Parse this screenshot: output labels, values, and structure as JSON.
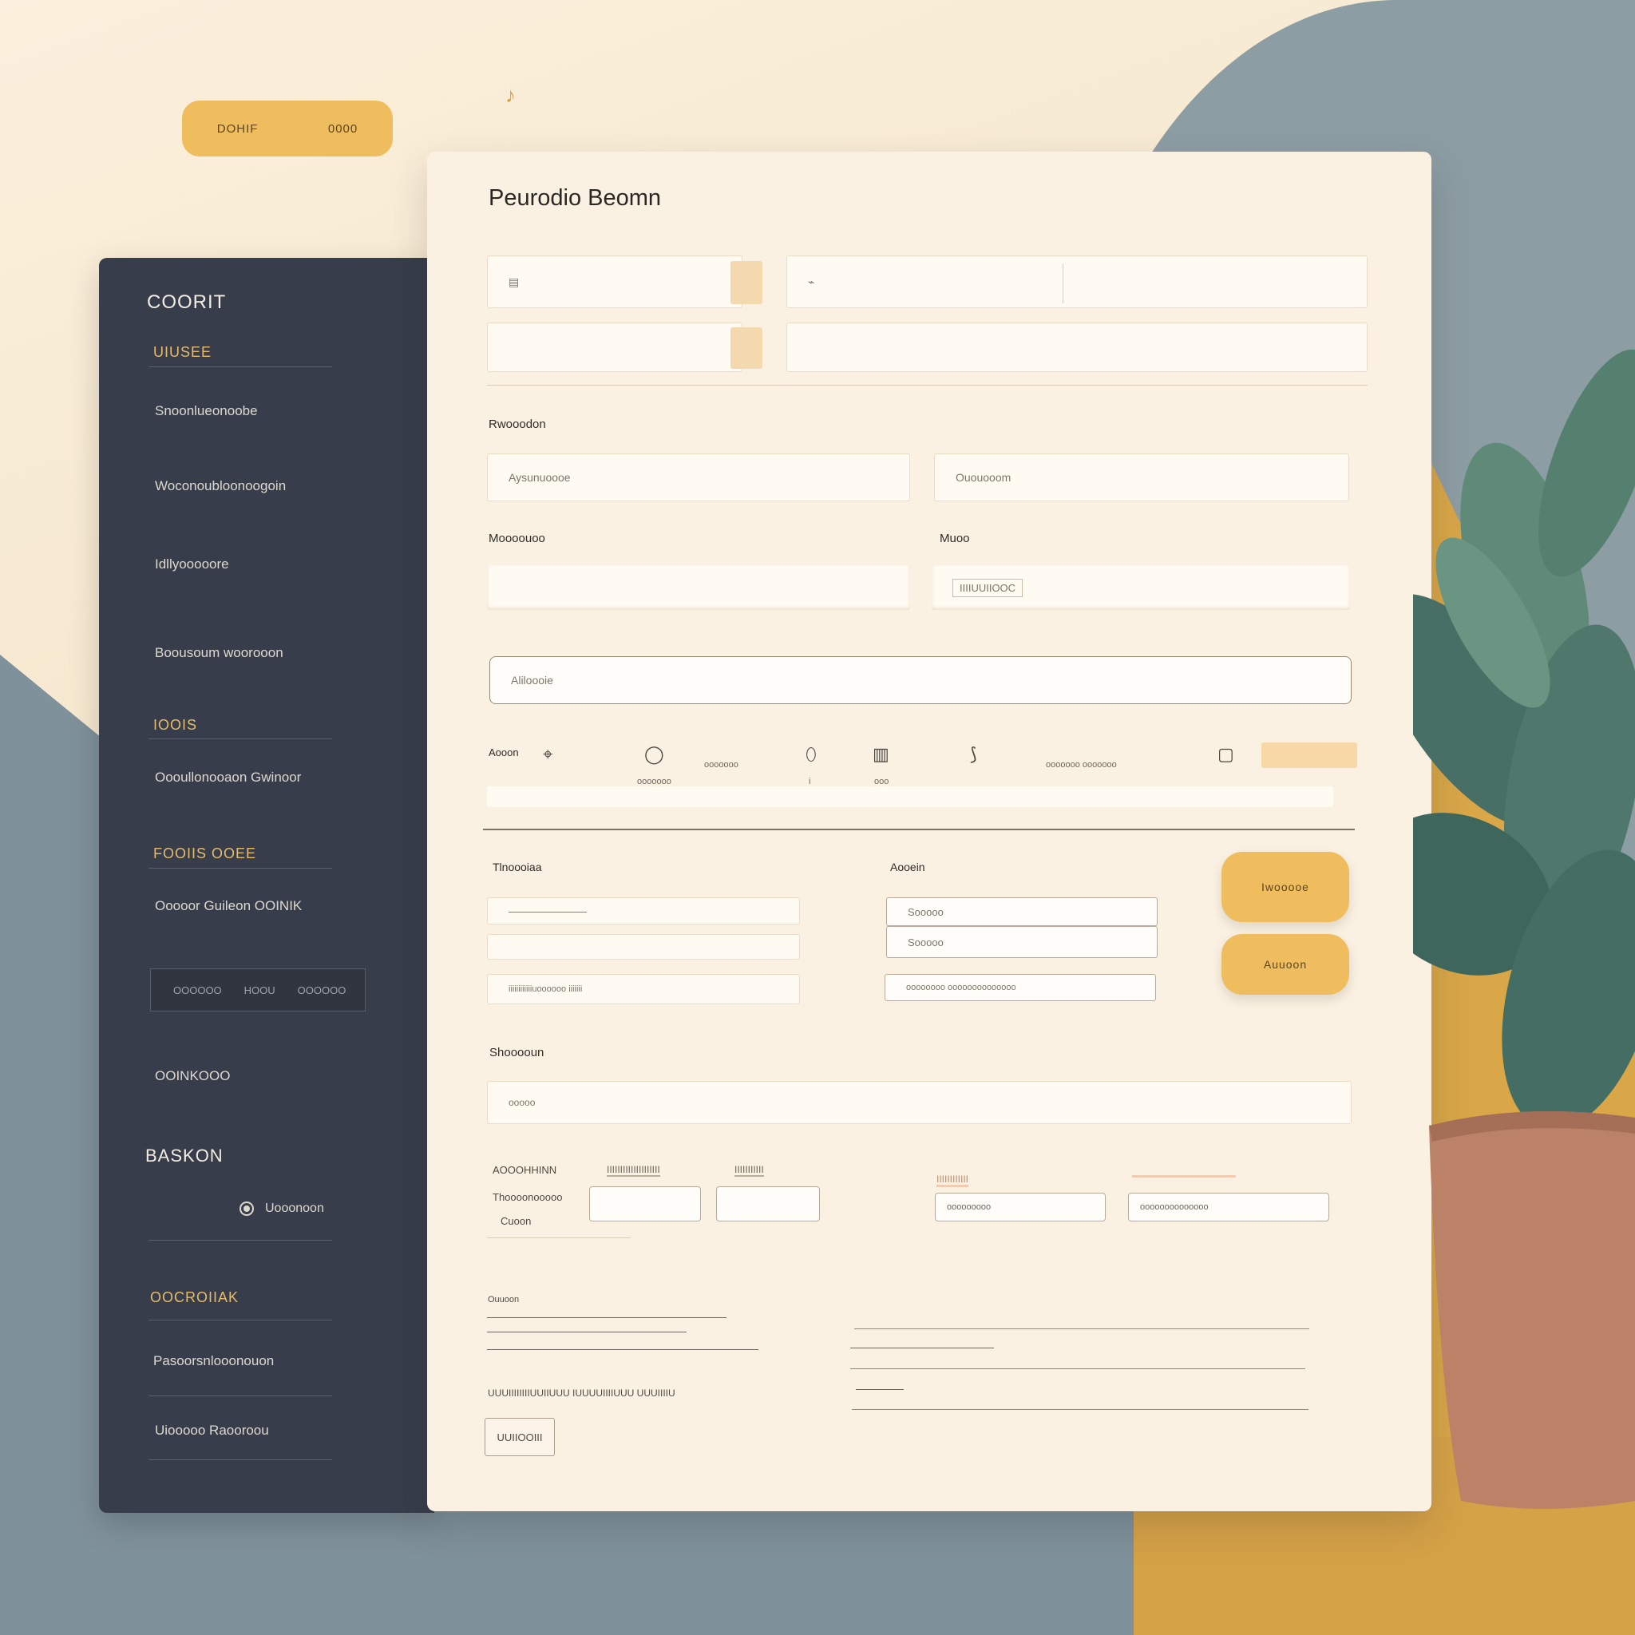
{
  "top_pill": {
    "left": "DOHIF",
    "right": "0000"
  },
  "sidebar": {
    "title": "COORIT",
    "sections": [
      {
        "label": "UIUSEE",
        "items": [
          "Snoonlueonoobe",
          "Woconoubloonoogoin",
          "Idllyooooore",
          "Boousoum woorooon"
        ]
      },
      {
        "label": "IOOIS",
        "items": [
          "Oooullonooaon Gwinoor"
        ]
      },
      {
        "label": "FOOIIS OOEE",
        "items": [
          "Ooooor Guileon OOINIK"
        ],
        "box": [
          "OOOOOO",
          "HOOU",
          "OOOOOO"
        ]
      },
      {
        "label": "",
        "items": [
          "OOINKOOO"
        ]
      },
      {
        "label": "BASKON",
        "radio": "Uooonoon"
      },
      {
        "label": "OOCROIIAK",
        "items": [
          "Pasoorsnlooonouon",
          "Uiooooo Raooroou"
        ]
      }
    ]
  },
  "form": {
    "title": "Peurodio Beomn",
    "row1": [
      {
        "placeholder": "▤"
      },
      {
        "placeholder": "⌁"
      }
    ],
    "section_label": "Rwooodon",
    "inputs_a": [
      "Aysunuoooe",
      "Ououooom"
    ],
    "labels_b": [
      "Moooouoo",
      "Muoo"
    ],
    "input_b_right": "IIIIUUIIOOC",
    "wide_input": "Aliloooie",
    "toolbar": {
      "label": "Aooon",
      "icons": [
        "pin-icon",
        "circle-icon",
        "ellipse-icon",
        "window-icon",
        "clip-icon",
        "square-icon"
      ],
      "captions": [
        "ooooooo",
        "ooooooo",
        "i",
        "ooo",
        "ooooooo ooooooo"
      ]
    },
    "left_block": {
      "label": "Tlnoooiaa",
      "fields": [
        "———————",
        "",
        "iiiiiiiiiiiiuoooooo iiiiiii"
      ]
    },
    "mid_block": {
      "label": "Aooein",
      "fields": [
        "Sooooo",
        "Sooooo",
        "oooooooo oooooooooooooo"
      ]
    },
    "buttons": [
      "Iwooooe",
      "Auuoon"
    ],
    "section2_label": "Shooooun",
    "input_c": "ooooo",
    "bottom_labels": [
      "AOOOHHINN",
      "Thoooonooooo",
      "Cuoon"
    ],
    "tags": [
      "IIIIIIIIIIIIIIIIIIII",
      "IIIIIIIIIII"
    ],
    "right_tags": [
      "IIIIIIIIIIII",
      ""
    ],
    "right_fields": [
      "ooooooooo",
      "oooooooooooooo"
    ],
    "sig": {
      "label": "Ouuoon",
      "bottom_label": "UUUIIIIIIIIUUIIUUU IUUUUIIIIUUU UUUIIIIU",
      "button": "UUIIOOIII"
    }
  },
  "colors": {
    "accent": "#efbd5d",
    "sidebar": "#373d4a",
    "card": "#fbf1e2",
    "plant": "#4f776c",
    "pot": "#bb8268"
  }
}
